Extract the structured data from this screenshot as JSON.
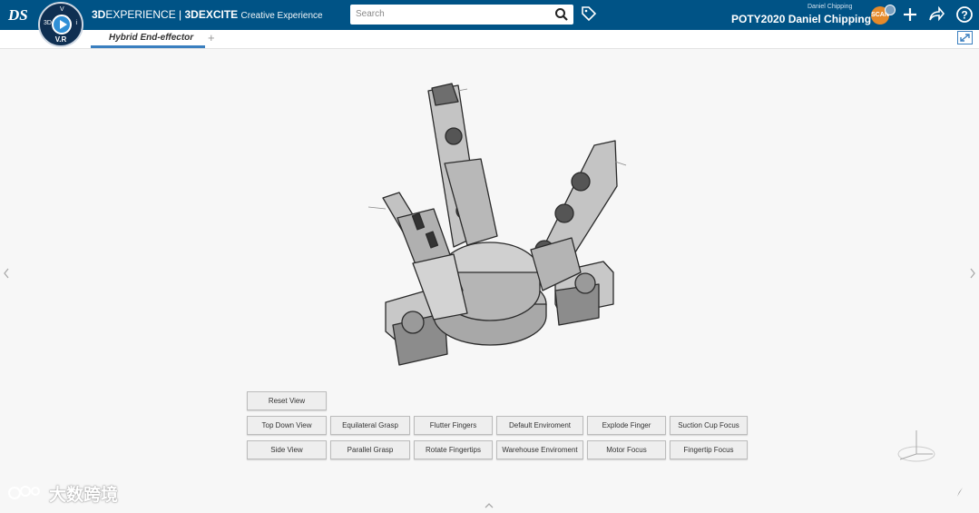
{
  "header": {
    "brand_bold": "3D",
    "brand_thin": "EXPERIENCE",
    "brand_sep": " | ",
    "brand_app": "3DEXCITE",
    "brand_ce": "Creative Experience",
    "compass_label": "V.R",
    "compass_left": "3D",
    "compass_right": "i",
    "compass_top": "V",
    "search_placeholder": "Search",
    "user_small": "Daniel Chipping",
    "user_main": "POTY2020 Daniel Chipping",
    "avatar_initials": "SCAN"
  },
  "tabs": [
    {
      "label": "Hybrid End-effector",
      "active": true
    }
  ],
  "tab_add": "+",
  "buttons": {
    "row1": [
      "Reset View"
    ],
    "row2": [
      "Top Down View",
      "Equilateral Grasp",
      "Flutter Fingers",
      "Default Enviroment",
      "Explode Finger",
      "Suction Cup Focus"
    ],
    "row3": [
      "Side View",
      "Parallel Grasp",
      "Rotate Fingertips",
      "Warehouse Enviroment",
      "Motor Focus",
      "Fingertip Focus"
    ]
  },
  "watermark": "大数跨境",
  "icons": [
    "ds-logo-icon",
    "compass-icon",
    "search-icon",
    "tag-icon",
    "add-icon",
    "share-icon",
    "help-icon",
    "expand-icon",
    "chevron-left-icon",
    "chevron-right-icon",
    "chevron-up-icon",
    "triad-icon"
  ],
  "colors": {
    "topbar": "#005386",
    "tab_accent": "#3a7fbf",
    "avatar": "#e58a2b"
  }
}
